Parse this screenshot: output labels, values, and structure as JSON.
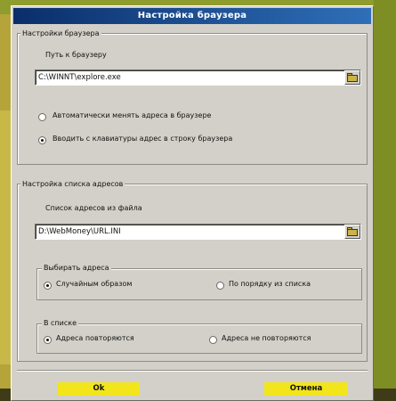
{
  "window": {
    "title": "Настройка браузера"
  },
  "browser_settings": {
    "group_label": "Настройки браузера",
    "path_label": "Путь к браузеру",
    "path_value": "C:\\WINNT\\explore.exe",
    "radio_auto": "Автоматически менять адреса в браузере",
    "radio_keyboard": "Вводить с клавиатуры адрес в строку браузера"
  },
  "address_list": {
    "group_label": "Настройка списка адресов",
    "file_label": "Список адресов из файла",
    "file_value": "D:\\WebMoney\\URL.INI",
    "choose": {
      "label": "Выбирать адреса",
      "random": "Случайным образом",
      "order": "По порядку из списка"
    },
    "in_list": {
      "label": "В списке",
      "repeat": "Адреса повторяются",
      "no_repeat": "Адреса не повторяются"
    }
  },
  "buttons": {
    "ok": "Ok",
    "cancel": "Отмена"
  }
}
